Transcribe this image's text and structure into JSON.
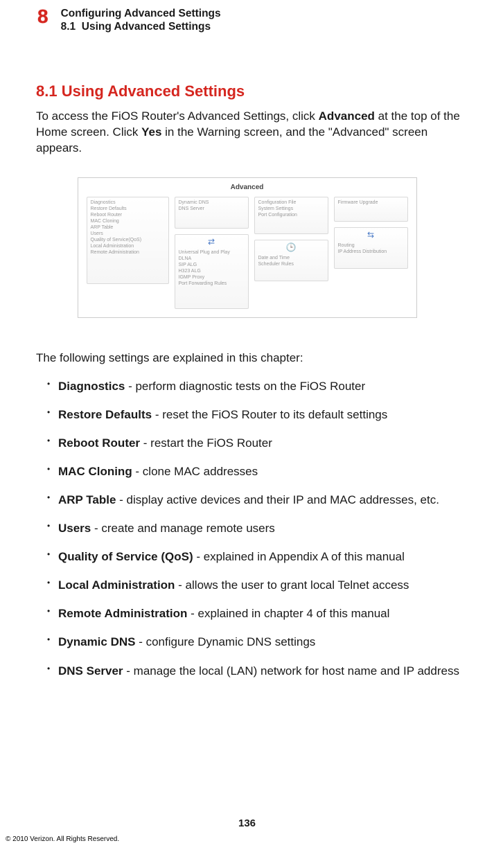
{
  "chapter": {
    "number": "8",
    "title": "Configuring Advanced Settings",
    "sub_number": "8.1",
    "sub_title": "Using Advanced Settings"
  },
  "section": {
    "heading": "8.1  Using Advanced Settings",
    "intro_1": "To access the FiOS Router's Advanced Settings, click ",
    "intro_b1": "Advanced",
    "intro_2": " at the top of the Home screen. Click ",
    "intro_b2": "Yes",
    "intro_3": " in the Warning screen, and the \"Advanced\" screen appears."
  },
  "screenshot": {
    "title": "Advanced",
    "panel1": [
      "Diagnostics",
      "Restore Defaults",
      "Reboot Router",
      "MAC Cloning",
      "ARP Table",
      "Users",
      "Quality of Service(QoS)",
      "Local Administration",
      "Remote Administration"
    ],
    "panel2": [
      "Dynamic DNS",
      "DNS Server"
    ],
    "panel3": [
      "Universal Plug and Play",
      "DLNA",
      "SIP ALG",
      "H323 ALG",
      "IGMP Proxy",
      "Port Forwarding Rules"
    ],
    "panel4": [
      "Configuration File",
      "System Settings",
      "Port Configuration"
    ],
    "panel5": [
      "Date and Time",
      "Scheduler Rules"
    ],
    "panel6": [
      "Firmware Upgrade"
    ],
    "panel7": [
      "Routing",
      "IP Address Distribution"
    ]
  },
  "settings_intro": "The following settings are explained in this chapter:",
  "settings": [
    {
      "term": "Diagnostics",
      "desc": " - perform diagnostic tests on the FiOS Router"
    },
    {
      "term": "Restore Defaults",
      "desc": " - reset the FiOS Router to its default settings"
    },
    {
      "term": "Reboot Router",
      "desc": " - restart the FiOS Router"
    },
    {
      "term": "MAC Cloning",
      "desc": " - clone MAC addresses"
    },
    {
      "term": "ARP Table",
      "desc": " - display active devices and their IP and MAC addresses, etc."
    },
    {
      "term": "Users",
      "desc": " - create and manage remote users"
    },
    {
      "term": "Quality of Service (QoS)",
      "desc": " - explained in Appendix A of this manual"
    },
    {
      "term": "Local Administration",
      "desc": " - allows the user to grant local Telnet access"
    },
    {
      "term": "Remote Administration",
      "desc": " - explained in chapter 4 of this manual"
    },
    {
      "term": "Dynamic DNS",
      "desc": " - configure Dynamic DNS settings"
    },
    {
      "term": "DNS Server",
      "desc": " - manage the local (LAN) network for host name and IP address"
    }
  ],
  "page_number": "136",
  "copyright": "© 2010 Verizon. All Rights Reserved."
}
